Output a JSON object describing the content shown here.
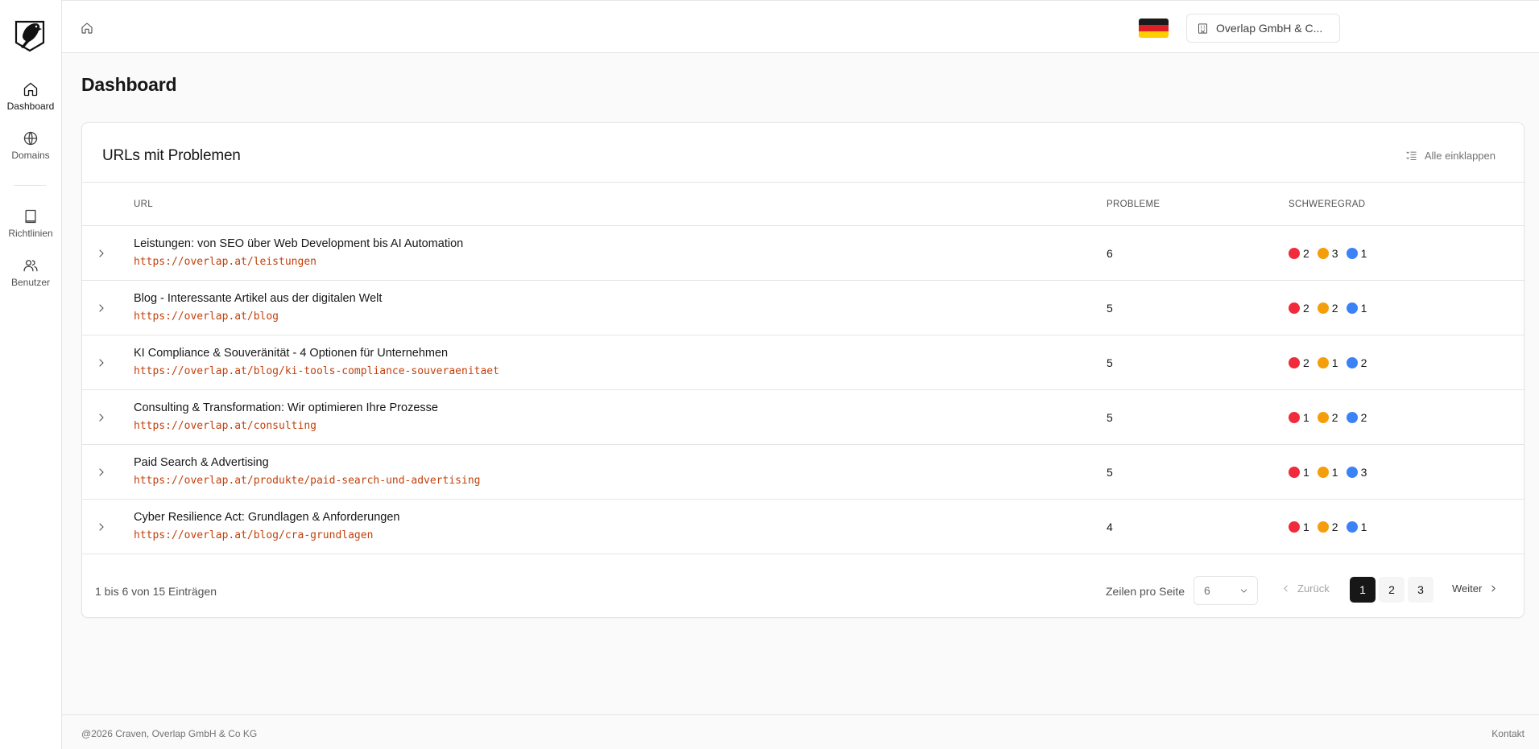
{
  "sidebar": {
    "items": [
      {
        "label": "Dashboard",
        "icon": "home-icon"
      },
      {
        "label": "Domains",
        "icon": "globe-icon"
      },
      {
        "label": "Richtlinien",
        "icon": "book-icon"
      },
      {
        "label": "Benutzer",
        "icon": "users-icon"
      }
    ]
  },
  "header": {
    "language_flag": "germany-flag-icon",
    "organization": "Overlap GmbH & C..."
  },
  "page": {
    "title": "Dashboard"
  },
  "card": {
    "title": "URLs mit Problemen",
    "collapse_all_label": "Alle einklappen",
    "columns": {
      "url": "URL",
      "problems": "PROBLEME",
      "severity": "SCHWEREGRAD"
    },
    "rows": [
      {
        "title": "Leistungen: von SEO über Web Development bis AI Automation",
        "url": "https://overlap.at/leistungen",
        "problems": "6",
        "high": "2",
        "medium": "3",
        "low": "1"
      },
      {
        "title": "Blog - Interessante Artikel aus der digitalen Welt",
        "url": "https://overlap.at/blog",
        "problems": "5",
        "high": "2",
        "medium": "2",
        "low": "1"
      },
      {
        "title": "KI Compliance & Souveränität - 4 Optionen für Unternehmen",
        "url": "https://overlap.at/blog/ki-tools-compliance-souveraenitaet",
        "problems": "5",
        "high": "2",
        "medium": "1",
        "low": "2"
      },
      {
        "title": "Consulting & Transformation: Wir optimieren Ihre Prozesse",
        "url": "https://overlap.at/consulting",
        "problems": "5",
        "high": "1",
        "medium": "2",
        "low": "2"
      },
      {
        "title": "Paid Search & Advertising",
        "url": "https://overlap.at/produkte/paid-search-und-advertising",
        "problems": "5",
        "high": "1",
        "medium": "1",
        "low": "3"
      },
      {
        "title": "Cyber Resilience Act: Grundlagen & Anforderungen",
        "url": "https://overlap.at/blog/cra-grundlagen",
        "problems": "4",
        "high": "1",
        "medium": "2",
        "low": "1"
      }
    ],
    "pagination": {
      "summary": "1 bis 6 von 15 Einträgen",
      "rows_per_page_label": "Zeilen pro Seite",
      "rows_per_page_value": "6",
      "prev_label": "Zurück",
      "next_label": "Weiter",
      "pages": [
        "1",
        "2",
        "3"
      ],
      "current_page": "1"
    }
  },
  "colors": {
    "severity_high": "#ef2b3c",
    "severity_medium": "#f59e0b",
    "severity_low": "#3b82f6",
    "url_text": "#c2410c"
  },
  "footer": {
    "copyright": "@2026 Craven, Overlap GmbH & Co KG",
    "contact": "Kontakt"
  }
}
